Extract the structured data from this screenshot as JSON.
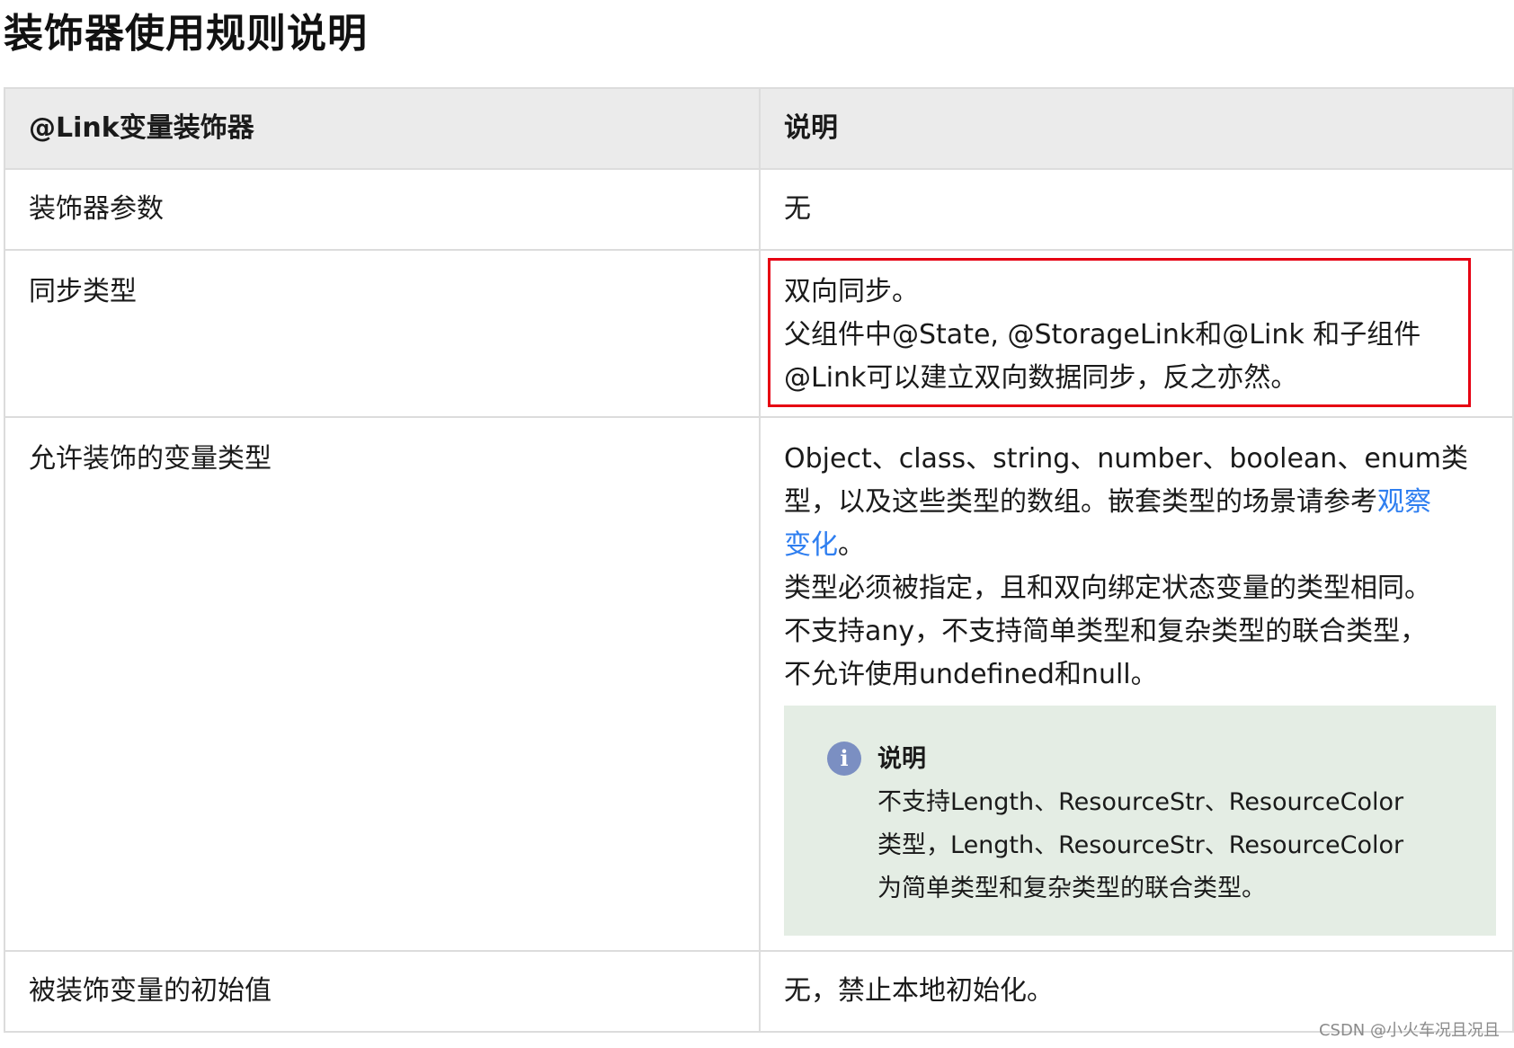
{
  "page": {
    "title": "装饰器使用规则说明"
  },
  "table": {
    "headers": [
      "@Link变量装饰器",
      "说明"
    ],
    "rows": {
      "params": {
        "label": "装饰器参数",
        "value": "无"
      },
      "sync": {
        "label": "同步类型",
        "lines": [
          "双向同步。",
          "父组件中@State, @StorageLink和@Link 和子组件",
          "@Link可以建立双向数据同步，反之亦然。"
        ]
      },
      "types": {
        "label": "允许装饰的变量类型",
        "line1": "Object、class、string、number、boolean、enum类",
        "line2_prefix": "型，以及这些类型的数组。嵌套类型的场景请参考",
        "link_part1": "观察",
        "link_part2": "变化",
        "line3_suffix": "。",
        "line4": "类型必须被指定，且和双向绑定状态变量的类型相同。",
        "line5": "不支持any，不支持简单类型和复杂类型的联合类型，",
        "line6": "不允许使用undefined和null。",
        "note": {
          "icon": "info-icon",
          "title": "说明",
          "lines": [
            "不支持Length、ResourceStr、ResourceColor",
            "类型，Length、ResourceStr、ResourceColor",
            "为简单类型和复杂类型的联合类型。"
          ]
        }
      },
      "init": {
        "label": "被装饰变量的初始值",
        "value": "无，禁止本地初始化。"
      }
    }
  },
  "watermark": "CSDN @小火车况且况且",
  "colors": {
    "highlight": "#e60012",
    "link": "#2e7ef0",
    "note_bg": "#e4ede4",
    "header_bg": "#ebebeb"
  }
}
